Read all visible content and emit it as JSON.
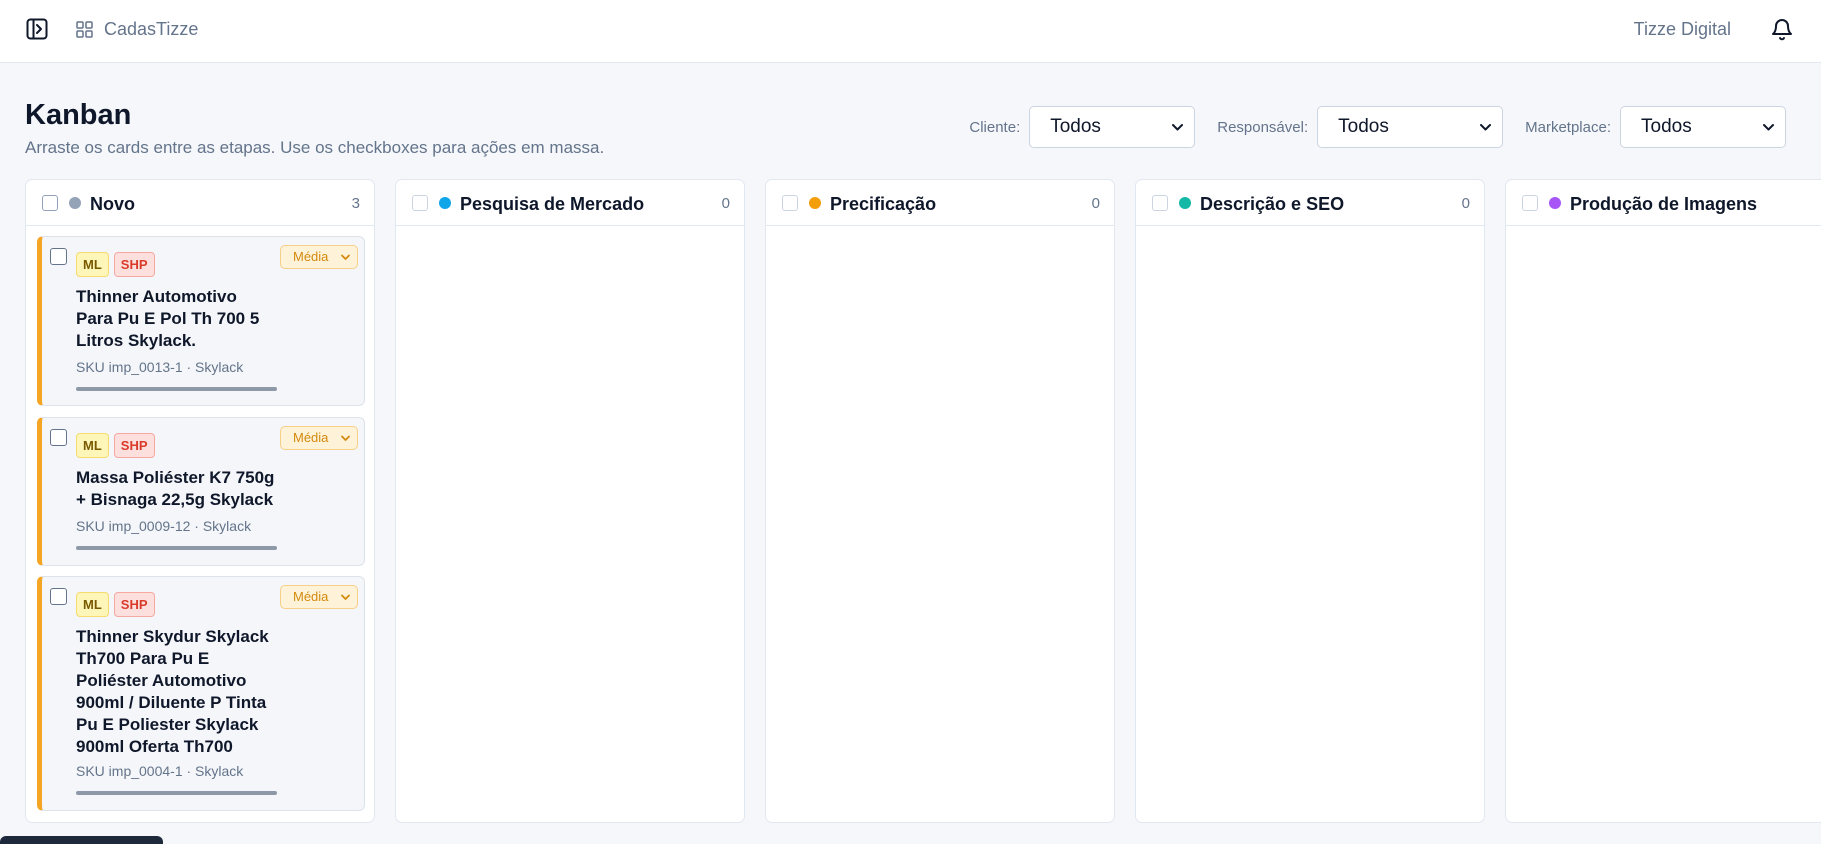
{
  "topbar": {
    "app_title": "CadasTizze",
    "org_name": "Tizze Digital"
  },
  "page": {
    "title": "Kanban",
    "subtitle": "Arraste os cards entre as etapas. Use os checkboxes para ações em massa."
  },
  "filters": [
    {
      "label": "Cliente:",
      "value": "Todos"
    },
    {
      "label": "Responsável:",
      "value": "Todos"
    },
    {
      "label": "Marketplace:",
      "value": "Todos"
    }
  ],
  "colors": {
    "novo": "#94a3b8",
    "pesquisa": "#0ea5e9",
    "precificacao": "#f59e0b",
    "descricao": "#14b8a6",
    "imagens": "#a855f7",
    "card_accent": "#f5a524"
  },
  "columns": [
    {
      "title": "Novo",
      "count": "3",
      "cards": [
        {
          "badges": [
            "ML",
            "SHP"
          ],
          "priority": "Média",
          "title": "Thinner Automotivo Para Pu E Pol Th 700 5 Litros Skylack.",
          "meta": "SKU imp_0013-1 · Skylack"
        },
        {
          "badges": [
            "ML",
            "SHP"
          ],
          "priority": "Média",
          "title": "Massa Poliéster K7 750g + Bisnaga 22,5g Skylack",
          "meta": "SKU imp_0009-12 · Skylack"
        },
        {
          "badges": [
            "ML",
            "SHP"
          ],
          "priority": "Média",
          "title": "Thinner Skydur Skylack Th700 Para Pu E Poliéster Automotivo 900ml / Diluente P Tinta Pu E Poliester Skylack 900ml Oferta Th700",
          "meta": "SKU imp_0004-1 · Skylack"
        }
      ]
    },
    {
      "title": "Pesquisa de Mercado",
      "count": "0",
      "cards": []
    },
    {
      "title": "Precificação",
      "count": "0",
      "cards": []
    },
    {
      "title": "Descrição e SEO",
      "count": "0",
      "cards": []
    },
    {
      "title": "Produção de Imagens",
      "count": "",
      "cards": []
    }
  ]
}
